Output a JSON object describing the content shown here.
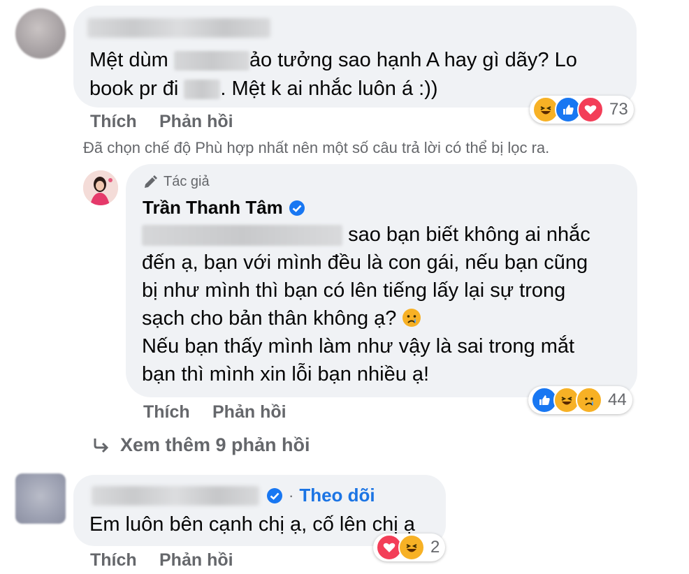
{
  "comment1": {
    "lines": [
      "Mệt dùm",
      "ảo tưởng sao hạnh A hay gì dãy? Lo",
      "book pr đi",
      ". Mệt k ai nhắc luôn á :))"
    ],
    "actions": {
      "like": "Thích",
      "reply": "Phản hồi"
    },
    "reactions": {
      "icons": [
        "haha-icon",
        "like-icon",
        "love-icon"
      ],
      "count": "73"
    }
  },
  "filter_note": "Đã chọn chế độ Phù hợp nhất nên một số câu trả lời có thể bị lọc ra.",
  "reply1": {
    "author_tag": "Tác giả",
    "author_name": "Trần Thanh Tâm",
    "lines": [
      "sao bạn biết không ai nhắc",
      "đến ạ, bạn với mình đều là con gái, nếu bạn cũng",
      "bị như mình thì bạn có lên tiếng lấy lại sự trong",
      "sạch cho bản thân không ạ?",
      "Nếu bạn thấy mình làm như vậy là sai trong mắt",
      "bạn thì mình xin lỗi bạn nhiều ạ!"
    ],
    "actions": {
      "like": "Thích",
      "reply": "Phản hồi"
    },
    "reactions": {
      "icons": [
        "like-icon",
        "haha-icon",
        "sad-icon"
      ],
      "count": "44"
    }
  },
  "view_more": "Xem thêm 9 phản hồi",
  "comment2": {
    "follow": "Theo dõi",
    "text": "Em luôn bên cạnh chị ạ, cố lên chị ạ",
    "actions": {
      "like": "Thích",
      "reply": "Phản hồi"
    },
    "reactions": {
      "icons": [
        "love-icon",
        "haha-icon"
      ],
      "count": "2"
    }
  },
  "colors": {
    "bubble": "#f0f2f5",
    "secondary_text": "#65676b",
    "link": "#1b74e4",
    "verified": "#1877f2"
  }
}
